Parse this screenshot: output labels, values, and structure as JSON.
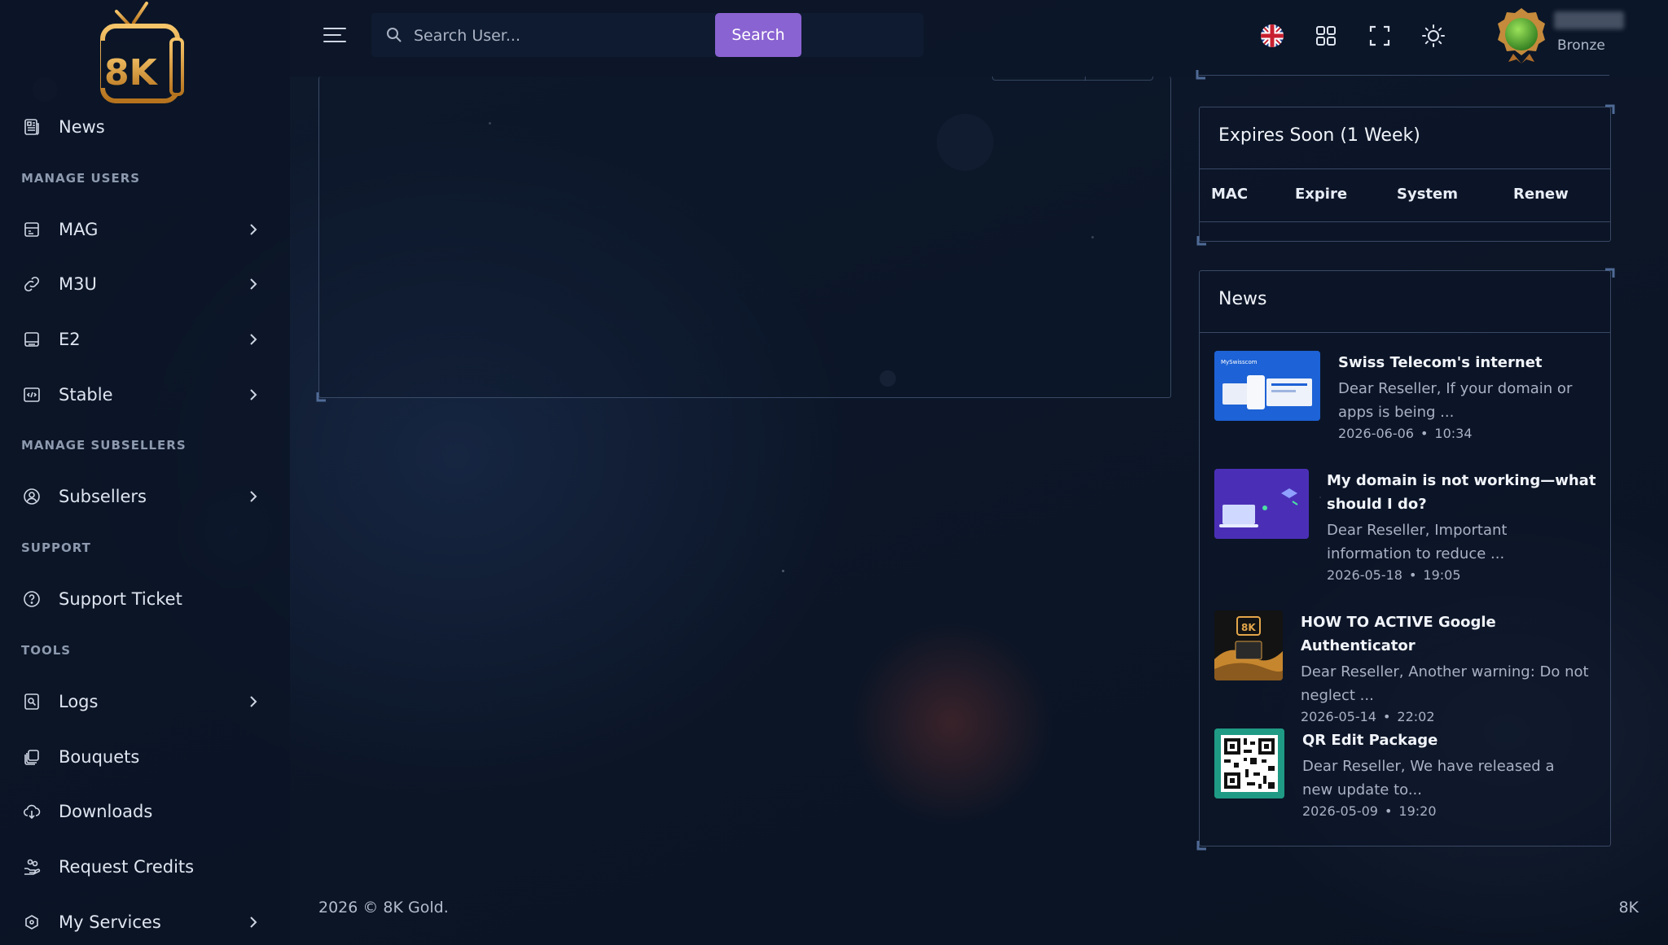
{
  "brand": {
    "logo_text": "8K"
  },
  "header": {
    "search_placeholder": "Search User...",
    "search_button": "Search",
    "user": {
      "rank": "Bronze"
    }
  },
  "sidebar": {
    "news": "News",
    "sections": {
      "manage_users": "MANAGE USERS",
      "manage_subsellers": "MANAGE SUBSELLERS",
      "support": "SUPPORT",
      "tools": "TOOLS"
    },
    "items": {
      "mag": "MAG",
      "m3u": "M3U",
      "e2": "E2",
      "stable": "Stable",
      "subsellers": "Subsellers",
      "support_ticket": "Support Ticket",
      "logs": "Logs",
      "bouquets": "Bouquets",
      "downloads": "Downloads",
      "request_credits": "Request Credits",
      "my_services": "My Services"
    }
  },
  "expires": {
    "title": "Expires Soon (1 Week)",
    "columns": [
      "MAC",
      "Expire",
      "System",
      "Renew"
    ]
  },
  "news": {
    "title": "News",
    "items": [
      {
        "title": "Swiss Telecom's internet",
        "desc1": "Dear Reseller, If your domain or",
        "desc2": "apps is being ...",
        "date": "2026-06-06",
        "time": "10:34",
        "thumb_label": "MySwisscom"
      },
      {
        "title1": "My domain is not working—what",
        "title2": "should I do?",
        "desc1": "Dear Reseller, Important",
        "desc2": "information to reduce ...",
        "date": "2026-05-18",
        "time": "19:05"
      },
      {
        "title": "HOW TO ACTIVE Google Authenticator",
        "desc1": "Dear Reseller, Another warning: Do not",
        "desc2": "neglect ...",
        "date": "2026-05-14",
        "time": "22:02",
        "thumb_label": "8K"
      },
      {
        "title": "QR Edit Package",
        "desc1": "Dear Reseller, We have released a",
        "desc2": "new update to...",
        "date": "2026-05-09",
        "time": "19:20"
      }
    ]
  },
  "footer": {
    "copyright": "2026 © 8K Gold.",
    "brand": "8K"
  },
  "colors": {
    "accent": "#8a63d2",
    "background": "#0c1628",
    "gold": "#d99a3a"
  }
}
